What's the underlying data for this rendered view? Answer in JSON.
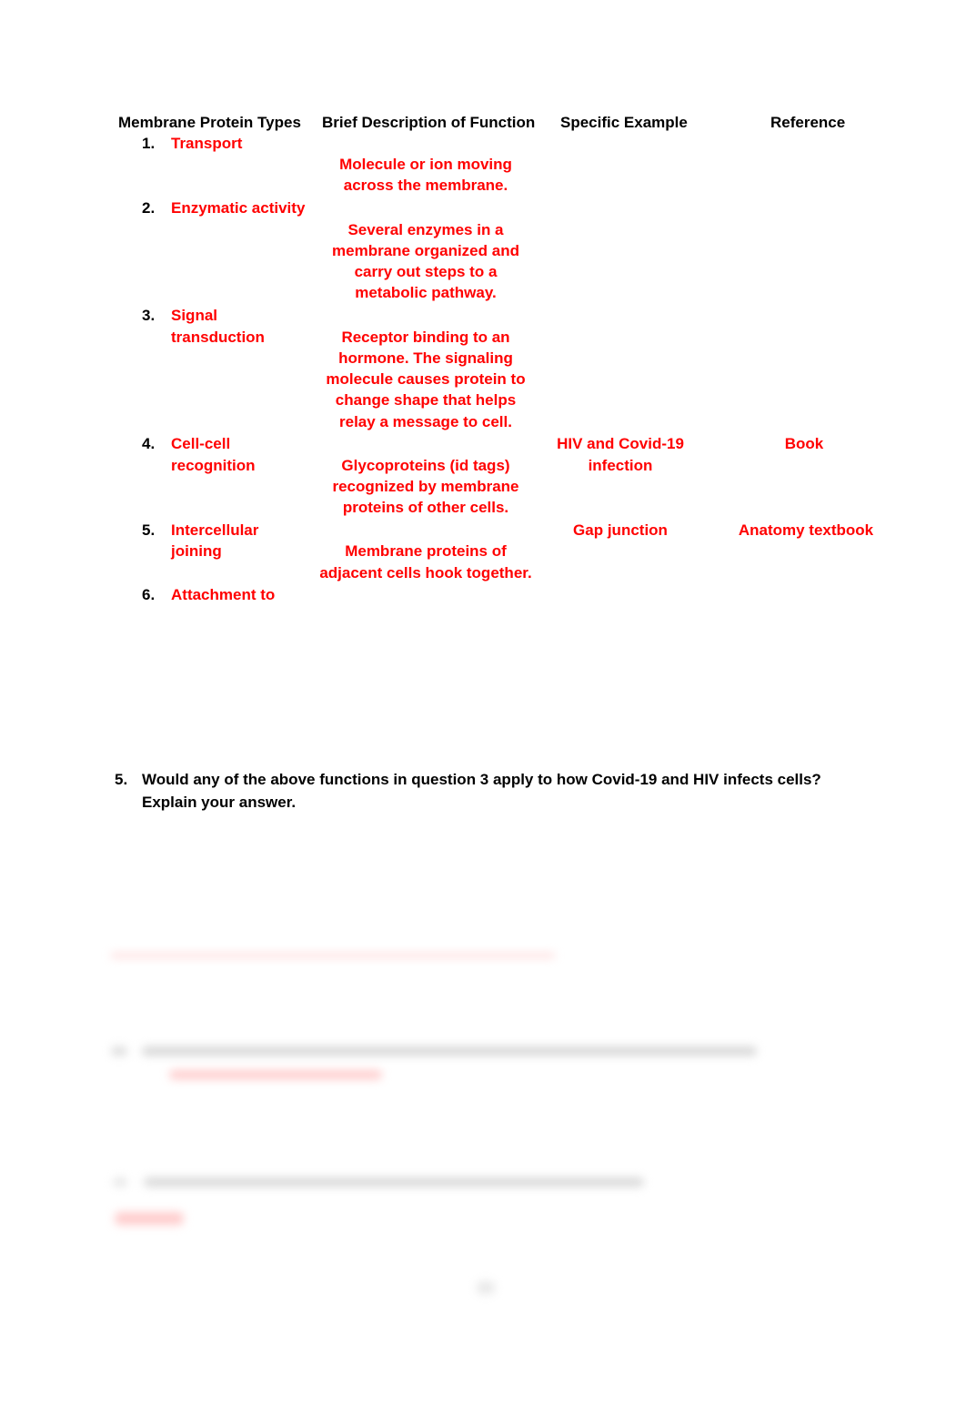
{
  "table": {
    "headers": [
      "Membrane Protein Types",
      "Brief Description of Function",
      "Specific Example",
      "Reference"
    ],
    "rows": [
      {
        "number": "1.",
        "type": [
          "Transport"
        ],
        "description": [
          "Molecule or ion moving",
          "across the membrane."
        ],
        "example": [],
        "reference": []
      },
      {
        "number": "2.",
        "type": [
          "Enzymatic activity"
        ],
        "description": [
          "Several enzymes in a",
          "membrane organized and",
          "carry out steps to a",
          "metabolic pathway."
        ],
        "example": [],
        "reference": []
      },
      {
        "number": "3.",
        "type": [
          "Signal",
          "transduction"
        ],
        "description": [
          "Receptor binding to an",
          "hormone. The signaling",
          "molecule causes protein to",
          "change shape that helps",
          "relay a message to cell."
        ],
        "example": [],
        "reference": []
      },
      {
        "number": "4.",
        "type": [
          "Cell-cell",
          "recognition"
        ],
        "description": [
          "Glycoproteins (id tags)",
          "recognized by membrane",
          "proteins of other cells."
        ],
        "example": [
          "HIV and Covid-19",
          "infection"
        ],
        "reference": [
          "Book"
        ]
      },
      {
        "number": "5.",
        "type": [
          "Intercellular",
          "joining"
        ],
        "description": [
          "Membrane proteins of",
          "adjacent cells hook together."
        ],
        "example": [
          "Gap junction"
        ],
        "reference": [
          "Anatomy textbook"
        ]
      },
      {
        "number": "6.",
        "type": [
          "Attachment to"
        ],
        "description": [],
        "example": [],
        "reference": []
      }
    ]
  },
  "question5": {
    "number": "5.",
    "lines": [
      "Would any of the above functions in question 3 apply to how Covid-19 and HIV infects cells?",
      "Explain your answer."
    ]
  },
  "colors": {
    "answer": "#ff0000",
    "text": "#000000"
  }
}
